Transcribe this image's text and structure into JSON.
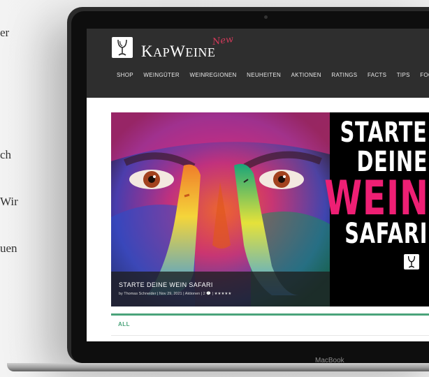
{
  "side_text": [
    "er",
    "ch",
    "Wir",
    "uen"
  ],
  "laptop": {
    "brand": "MacBook"
  },
  "site": {
    "logo_text_big": "K",
    "logo_text_rest": "AP",
    "logo_text_w": "W",
    "logo_text_rest2": "EINE",
    "logo_new": "New",
    "nav": [
      "SHOP",
      "WEINGÜTER",
      "WEINREGIONEN",
      "NEUHEITEN",
      "AKTIONEN",
      "RATINGS",
      "FACTS",
      "TIPS",
      "FOOD"
    ],
    "hero": {
      "title": "STARTE DEINE WEIN SAFARI",
      "meta": "by Thomas Schneider | Nov 29, 2021 | Aktionen | 2 💬 | ★★★★★"
    },
    "promo": {
      "line1": "STARTE",
      "line2": "DEINE",
      "line3": "WEIN",
      "line4": "SAFARI"
    },
    "tabs": {
      "all": "ALL"
    }
  },
  "colors": {
    "accent_green": "#4aa37a",
    "promo_pink": "#ee1f74",
    "header_bg": "#2e2e2e"
  },
  "icons": [
    "wine-glass-logo-icon",
    "comment-icon",
    "star-icon"
  ]
}
